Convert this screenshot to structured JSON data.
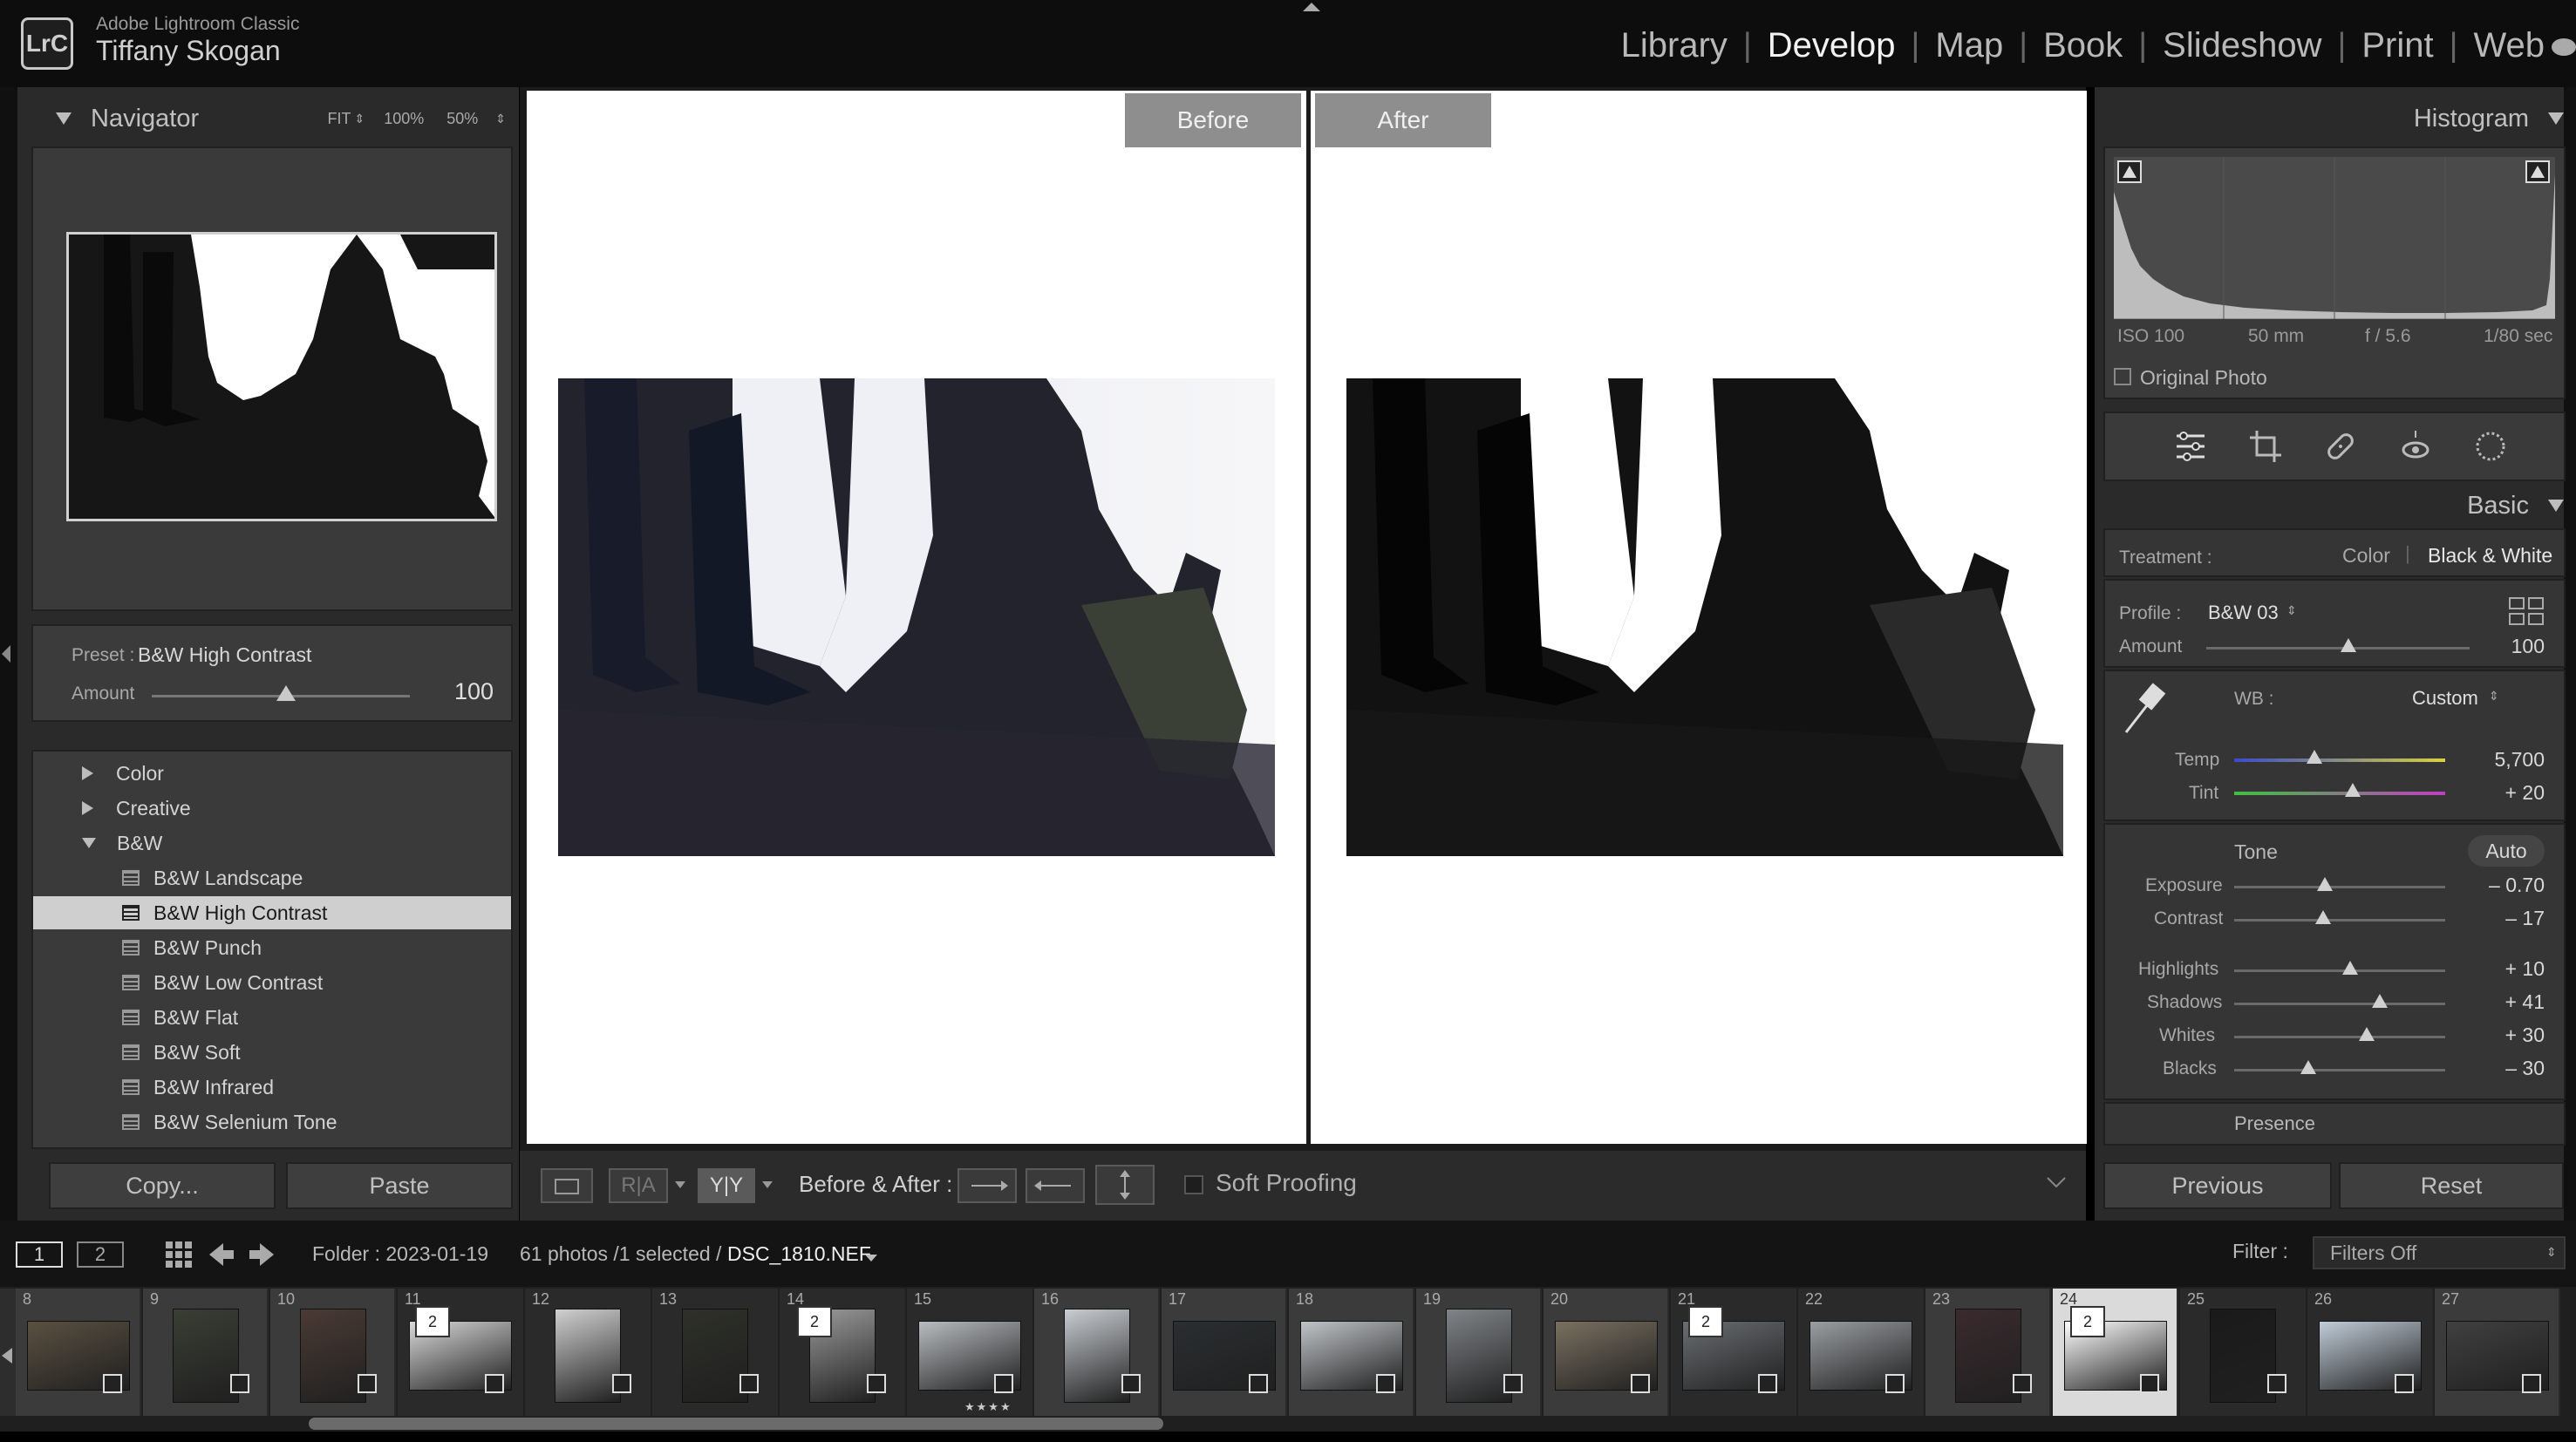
{
  "app": {
    "name": "Adobe Lightroom Classic",
    "logo": "LrC",
    "user": "Tiffany Skogan"
  },
  "modules": [
    "Library",
    "Develop",
    "Map",
    "Book",
    "Slideshow",
    "Print",
    "Web"
  ],
  "active_module": "Develop",
  "navigator": {
    "title": "Navigator",
    "zoom_fit": "FIT",
    "zoom_100": "100%",
    "zoom_50": "50%"
  },
  "preset_amount": {
    "preset_label": "Preset :",
    "preset_name": "B&W High Contrast",
    "amount_label": "Amount",
    "amount_value": "100",
    "amount_fraction": 0.52
  },
  "presets": {
    "groups": [
      {
        "label": "Color",
        "expanded": false
      },
      {
        "label": "Creative",
        "expanded": false
      },
      {
        "label": "B&W",
        "expanded": true
      }
    ],
    "items": [
      "B&W Landscape",
      "B&W High Contrast",
      "B&W Punch",
      "B&W Low Contrast",
      "B&W Flat",
      "B&W Soft",
      "B&W Infrared",
      "B&W Selenium Tone"
    ],
    "selected": "B&W High Contrast"
  },
  "left_buttons": {
    "copy": "Copy...",
    "paste": "Paste"
  },
  "compare": {
    "before": "Before",
    "after": "After"
  },
  "toolbar": {
    "ba_label": "Before & After :",
    "soft_proofing": "Soft Proofing",
    "ra_label": "R|A",
    "yy_label": "Y|Y"
  },
  "histogram": {
    "title": "Histogram",
    "iso": "ISO 100",
    "focal": "50 mm",
    "aperture": "f / 5.6",
    "shutter": "1/80 sec",
    "original_photo": "Original Photo"
  },
  "basic": {
    "title": "Basic",
    "treatment_label": "Treatment :",
    "treatment_color": "Color",
    "treatment_bw": "Black & White",
    "profile_label": "Profile :",
    "profile_value": "B&W 03",
    "amount_label": "Amount",
    "amount_value": "100",
    "wb_label": "WB :",
    "wb_value": "Custom",
    "temp_label": "Temp",
    "temp_value": "5,700",
    "tint_label": "Tint",
    "tint_value": "+ 20",
    "tone_label": "Tone",
    "auto_label": "Auto",
    "exposure_label": "Exposure",
    "exposure_value": "– 0.70",
    "contrast_label": "Contrast",
    "contrast_value": "– 17",
    "highlights_label": "Highlights",
    "highlights_value": "+ 10",
    "shadows_label": "Shadows",
    "shadows_value": "+ 41",
    "whites_label": "Whites",
    "whites_value": "+ 30",
    "blacks_label": "Blacks",
    "blacks_value": "– 30",
    "presence_label": "Presence"
  },
  "right_buttons": {
    "previous": "Previous",
    "reset": "Reset"
  },
  "filmbar": {
    "page1": "1",
    "page2": "2",
    "folder": "Folder : 2023-01-19",
    "count": "61 photos /1 selected /",
    "filename": "DSC_1810.NEF",
    "filter_label": "Filter :",
    "filter_value": "Filters Off"
  },
  "filmstrip": {
    "numbers": [
      "8",
      "9",
      "10",
      "11",
      "12",
      "13",
      "14",
      "15",
      "16",
      "17",
      "18",
      "19",
      "20",
      "21",
      "22",
      "23",
      "24",
      "25",
      "26",
      "27"
    ],
    "stack_counts": {
      "11": "2",
      "14": "2",
      "21": "2",
      "24": "2"
    },
    "rating_under_15": "★★★★",
    "selected": "24"
  },
  "colors": {
    "accent_selected": "#cfcfcf",
    "panel": "#2a2a2a",
    "temp_gradient": [
      "#3a4cc8",
      "#d8d040"
    ],
    "tint_gradient": [
      "#40c040",
      "#c040c0"
    ]
  }
}
